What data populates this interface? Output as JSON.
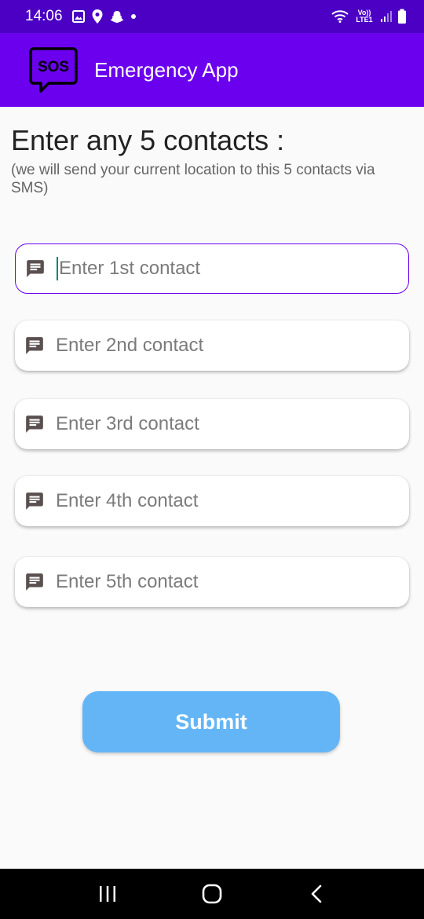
{
  "status_bar": {
    "time": "14:06",
    "network_label": "Vo)) LTE1"
  },
  "app_bar": {
    "logo_text": "SOS",
    "title": "Emergency App"
  },
  "content": {
    "heading": "Enter any 5 contacts :",
    "subheading": "(we will send your current location to this 5 contacts via SMS)",
    "fields": [
      {
        "placeholder": "Enter 1st contact",
        "icon": "message-icon"
      },
      {
        "placeholder": "Enter 2nd contact",
        "icon": "message-icon"
      },
      {
        "placeholder": "Enter 3rd contact",
        "icon": "message-icon"
      },
      {
        "placeholder": "Enter 4th contact",
        "icon": "message-icon"
      },
      {
        "placeholder": "Enter 5th contact",
        "icon": "message-icon"
      }
    ],
    "submit_label": "Submit"
  },
  "colors": {
    "status_bar": "#4b00c4",
    "app_bar": "#6a00ee",
    "submit_button": "#64b5f6",
    "focus_border": "#6a00ee"
  }
}
